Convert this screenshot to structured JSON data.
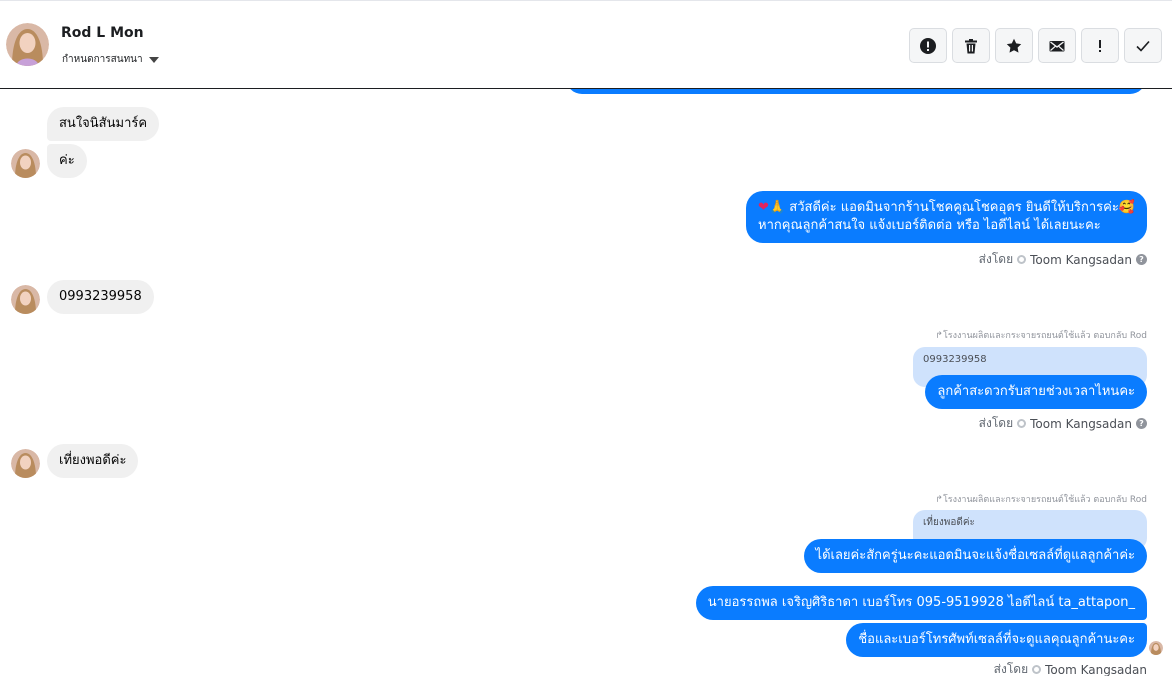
{
  "header": {
    "name": "Rod L Mon",
    "subtitle": "กำหนดการสนทนา"
  },
  "toolbar": {
    "buttons": [
      {
        "icon": "alert-circle-icon",
        "name": "spam-button"
      },
      {
        "icon": "trash-icon",
        "name": "delete-button"
      },
      {
        "icon": "star-icon",
        "name": "star-button"
      },
      {
        "icon": "envelope-icon",
        "name": "mark-unread-button"
      },
      {
        "icon": "exclamation-icon",
        "name": "follow-up-button"
      },
      {
        "icon": "checkmark-icon",
        "name": "done-button"
      }
    ]
  },
  "messages": {
    "m1": "สนใจนิสันมาร์ค",
    "m2": "ค่ะ",
    "m3_line1": "สวัสดีค่ะ แอดมินจากร้านโชคคูณโชคอุดร ยินดีให้บริการค่ะ",
    "m3_line2": "หากคุณลูกค้าสนใจ แจ้งเบอร์ติดต่อ หรือ ไอดีไลน์ ได้เลยนะคะ",
    "m4": "0993239958",
    "reply1_note": "โรงงานผลิตและกระจายรถยนต์ใช้แล้ว ตอบกลับ Rod",
    "reply1_quote": "0993239958",
    "m5": "ลูกค้าสะดวกรับสายช่วงเวลาไหนคะ",
    "m6": "เที่ยงพอดีค่ะ",
    "reply2_note": "โรงงานผลิตและกระจายรถยนต์ใช้แล้ว ตอบกลับ Rod",
    "reply2_quote": "เที่ยงพอดีค่ะ",
    "m7": "ได้เลยค่ะสักครู่นะคะแอดมินจะแจ้งชื่อเซลล์ที่ดูแลลูกค้าค่ะ",
    "m8": "นายอรรถพล เจริญศิริธาดา     เบอร์โทร 095-9519928 ไอดีไลน์ ta_attapon_",
    "m9": "ชื่อและเบอร์โทรศัพท์เซลล์ที่จะดูแลคุณลูกค้านะคะ"
  },
  "sent_by": {
    "prefix": "ส่งโดย",
    "agent": "Toom Kangsadan"
  },
  "colors": {
    "outgoing": "#0a7cff",
    "incoming": "#f0f0f0",
    "quote": "#cfe2fc"
  }
}
